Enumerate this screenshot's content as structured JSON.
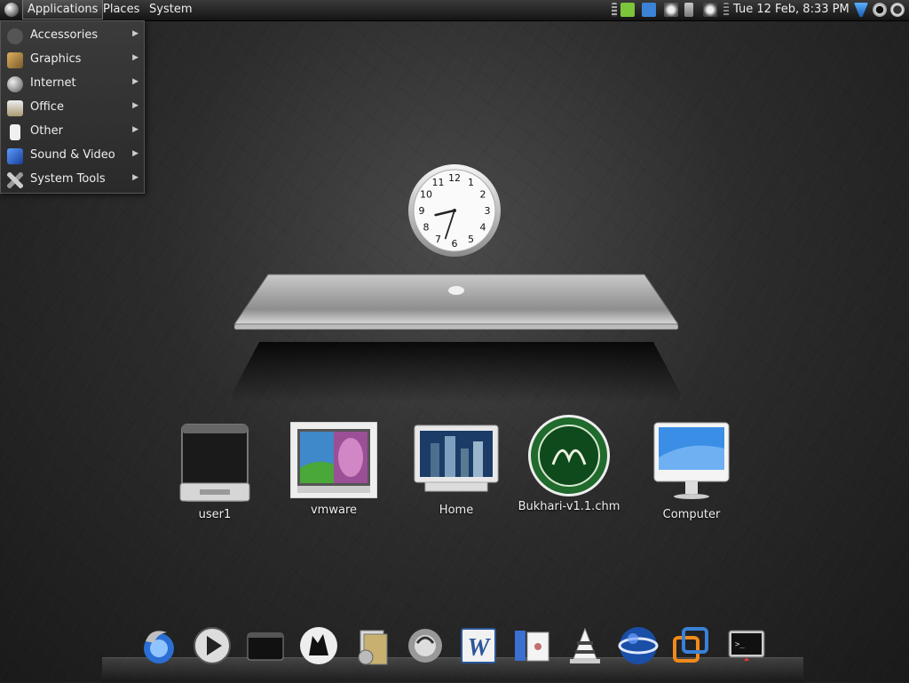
{
  "panel": {
    "menus": [
      "Applications",
      "Places",
      "System"
    ],
    "datetime": "Tue 12 Feb,  8:33 PM",
    "tray_icons": [
      "workspace-switcher-icon",
      "network-monitor-icon",
      "notes-icon",
      "screenshot-icon",
      "power-plug-icon",
      "camera-icon",
      "separator-icon"
    ],
    "right_icons": [
      "network-icon",
      "search-icon",
      "shutdown-icon"
    ]
  },
  "app_menu": {
    "items": [
      {
        "label": "Accessories",
        "icon": "accessories-icon",
        "color": "#6a6a6a"
      },
      {
        "label": "Graphics",
        "icon": "graphics-icon",
        "color": "#b08c50"
      },
      {
        "label": "Internet",
        "icon": "internet-icon",
        "color": "#999999"
      },
      {
        "label": "Office",
        "icon": "office-icon",
        "color": "#c9b98a"
      },
      {
        "label": "Other",
        "icon": "other-icon",
        "color": "#e6e6e6"
      },
      {
        "label": "Sound & Video",
        "icon": "sound-video-icon",
        "color": "#3a6ed6"
      },
      {
        "label": "System Tools",
        "icon": "system-tools-icon",
        "color": "#bbbbbb"
      }
    ]
  },
  "clock": {
    "numbers": [
      "12",
      "1",
      "2",
      "3",
      "4",
      "5",
      "6",
      "7",
      "8",
      "9",
      "10",
      "11"
    ],
    "hour": 8,
    "minute": 33
  },
  "desktop_icons": [
    {
      "label": "user1",
      "icon": "drive-icon"
    },
    {
      "label": "vmware",
      "icon": "vmware-icon"
    },
    {
      "label": "Home",
      "icon": "home-folder-icon"
    },
    {
      "label": "Bukhari-v1.1.chm",
      "icon": "chm-document-icon"
    },
    {
      "label": "Computer",
      "icon": "computer-icon"
    }
  ],
  "dock": {
    "items": [
      {
        "name": "firefox-icon"
      },
      {
        "name": "media-player-icon"
      },
      {
        "name": "terminal-window-icon"
      },
      {
        "name": "wolf-icon"
      },
      {
        "name": "file-manager-icon"
      },
      {
        "name": "evolution-icon"
      },
      {
        "name": "word-icon"
      },
      {
        "name": "binary-document-icon"
      },
      {
        "name": "vlc-icon"
      },
      {
        "name": "google-earth-icon"
      },
      {
        "name": "vmware-dock-icon"
      },
      {
        "name": "terminal-icon"
      }
    ]
  }
}
